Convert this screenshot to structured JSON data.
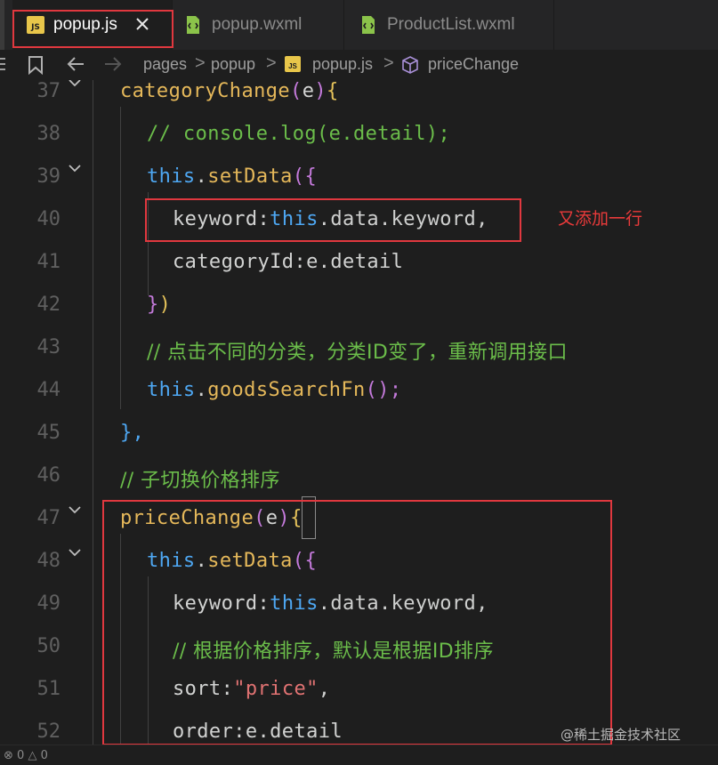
{
  "tabs": [
    {
      "label": "popup.js",
      "icon": "js-file-icon",
      "active": true
    },
    {
      "label": "popup.wxml",
      "icon": "wxml-file-icon",
      "active": false
    },
    {
      "label": "ProductList.wxml",
      "icon": "wxml-file-icon",
      "active": false
    }
  ],
  "breadcrumb": {
    "parts": [
      "pages",
      "popup",
      "popup.js",
      "priceChange"
    ],
    "separator": ">"
  },
  "line_numbers": [
    "37",
    "38",
    "39",
    "40",
    "41",
    "42",
    "43",
    "44",
    "45",
    "46",
    "47",
    "48",
    "49",
    "50",
    "51",
    "52"
  ],
  "code": {
    "l37": {
      "fn": "categoryChange",
      "p1": "(",
      "arg": "e",
      "p2": ")",
      "b": "{"
    },
    "l38": {
      "comment": "// console.log(e.detail);"
    },
    "l39": {
      "kw": "this",
      "dot": ".",
      "fn": "setData",
      "p": "(",
      "b": "{"
    },
    "l40": {
      "key": "keyword:",
      "kw": "this",
      "rest": ".data.keyword,"
    },
    "l41": {
      "key": "categoryId:",
      "rest": "e.detail"
    },
    "l42": {
      "b": "}",
      "p": ")"
    },
    "l43": {
      "comment": "// 点击不同的分类，分类ID变了，重新调用接口"
    },
    "l44": {
      "kw": "this",
      "dot": ".",
      "fn": "goodsSearchFn",
      "p": "();"
    },
    "l45": {
      "text": "},"
    },
    "l46": {
      "comment": "// 子切换价格排序"
    },
    "l47": {
      "fn": "priceChange",
      "p1": "(",
      "arg": "e",
      "p2": ")",
      "b": "{"
    },
    "l48": {
      "kw": "this",
      "dot": ".",
      "fn": "setData",
      "p": "(",
      "b": "{"
    },
    "l49": {
      "key": "keyword:",
      "kw": "this",
      "rest": ".data.keyword,"
    },
    "l50": {
      "comment": "// 根据价格排序，默认是根据ID排序"
    },
    "l51": {
      "key": "sort:",
      "str": "\"price\"",
      "rest": ","
    },
    "l52": {
      "key": "order:",
      "rest": "e.detail"
    }
  },
  "annotation": "又添加一行",
  "watermark": "@稀土掘金技术社区",
  "status": {
    "errors": "0",
    "warnings": "0"
  },
  "colors": {
    "highlight": "#e0383f",
    "function": "#e5b85a",
    "keyword": "#4ea7f2",
    "comment": "#6bbd4a",
    "string": "#e07272"
  }
}
